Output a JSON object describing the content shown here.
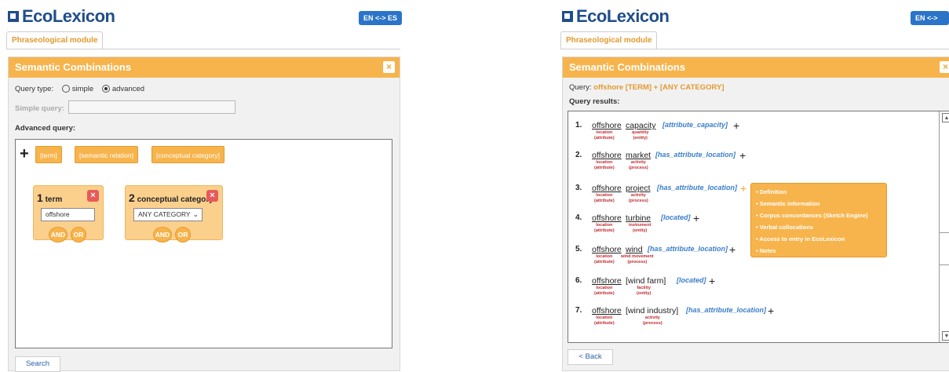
{
  "app": {
    "logo_text": "EcoLexicon",
    "lang_button": "EN <-> ES",
    "tab": "Phraseological module"
  },
  "left": {
    "panel_title": "Semantic Combinations",
    "close": "×",
    "query_type_label": "Query type:",
    "option_simple": "simple",
    "option_advanced": "advanced",
    "selected": "advanced",
    "simple_query_label": "Simple query:",
    "simple_query_value": "",
    "advanced_query_label": "Advanced query:",
    "plus": "+",
    "palette": [
      "[term]",
      "[semantic relation]",
      "[conceptual category]"
    ],
    "cards": [
      {
        "num": "1",
        "title": "term",
        "value": "offshore",
        "and": "AND",
        "or": "OR"
      },
      {
        "num": "2",
        "title": "conceptual category",
        "value": "ANY CATEGORY",
        "and": "AND",
        "or": "OR"
      }
    ],
    "search_button": "Search"
  },
  "right": {
    "panel_title": "Semantic Combinations",
    "close": "×",
    "query_prefix": "Query:",
    "query_value": "offshore [TERM] + [ANY CATEGORY]",
    "results_label": "Query results:",
    "results": [
      {
        "n": "1.",
        "w1": "offshore",
        "s1": [
          "location",
          "(attribute)"
        ],
        "w2": "capacity",
        "s2": [
          "quantity",
          "(entity)"
        ],
        "rel": "[attribute_capacity]"
      },
      {
        "n": "2.",
        "w1": "offshore",
        "s1": [
          "location",
          "(attribute)"
        ],
        "w2": "market",
        "s2": [
          "activity",
          "(process)"
        ],
        "rel": "[has_attribute_location]"
      },
      {
        "n": "3.",
        "w1": "offshore",
        "s1": [
          "location",
          "(attribute)"
        ],
        "w2": "project",
        "s2": [
          "activity",
          "(process)"
        ],
        "rel": "[has_attribute_location]"
      },
      {
        "n": "4.",
        "w1": "offshore",
        "s1": [
          "location",
          "(attribute)"
        ],
        "w2": "turbine",
        "s2": [
          "instrument",
          "(entity)"
        ],
        "rel": "[located]"
      },
      {
        "n": "5.",
        "w1": "offshore",
        "s1": [
          "location",
          "(attribute)"
        ],
        "w2": "wind",
        "s2": [
          "wind movement",
          "(process)"
        ],
        "rel": "[has_attribute_location]"
      },
      {
        "n": "6.",
        "w1": "offshore",
        "s1": [
          "location",
          "(attribute)"
        ],
        "w2": "[wind farm]",
        "s2": [
          "facility",
          "(entity)"
        ],
        "rel": "[located]"
      },
      {
        "n": "7.",
        "w1": "offshore",
        "s1": [
          "location",
          "(attribute)"
        ],
        "w2": "[wind industry]",
        "s2": [
          "activity",
          "(process)"
        ],
        "rel": "[has_attribute_location]"
      }
    ],
    "plus": "+",
    "menu": [
      "• Definition",
      "• Semantic information",
      "• Corpus concordances (Sketch Engine)",
      "• Verbal collocations",
      "• Access to entry in EcoLexicon",
      "• Notes"
    ],
    "back_button": "< Back"
  },
  "colors": {
    "accent": "#f7b44c",
    "brand": "#1f4e8c",
    "relation": "#3a7ecb",
    "sub": "#c0292f"
  }
}
